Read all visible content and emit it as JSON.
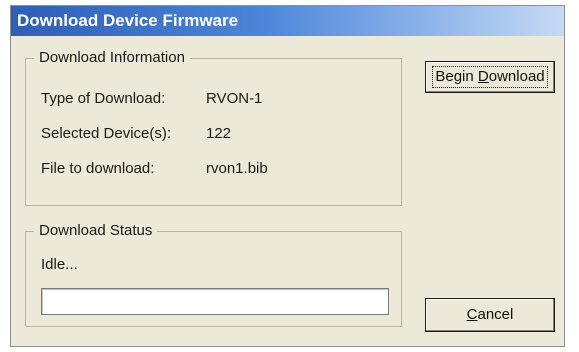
{
  "window": {
    "title": "Download Device Firmware"
  },
  "info_group": {
    "legend": "Download Information",
    "rows": [
      {
        "label": "Type of Download:",
        "value": "RVON-1"
      },
      {
        "label": "Selected Device(s):",
        "value": "122"
      },
      {
        "label": "File to download:",
        "value": "rvon1.bib"
      }
    ]
  },
  "status_group": {
    "legend": "Download Status",
    "status_text": "Idle...",
    "progress_percent": 0
  },
  "buttons": {
    "begin_pre": "Begin ",
    "begin_mnemonic": "D",
    "begin_post": "ownload",
    "cancel_mnemonic": "C",
    "cancel_post": "ancel"
  },
  "colors": {
    "title_start": "#2f5fb5",
    "dialog_bg": "#ece9d8"
  }
}
